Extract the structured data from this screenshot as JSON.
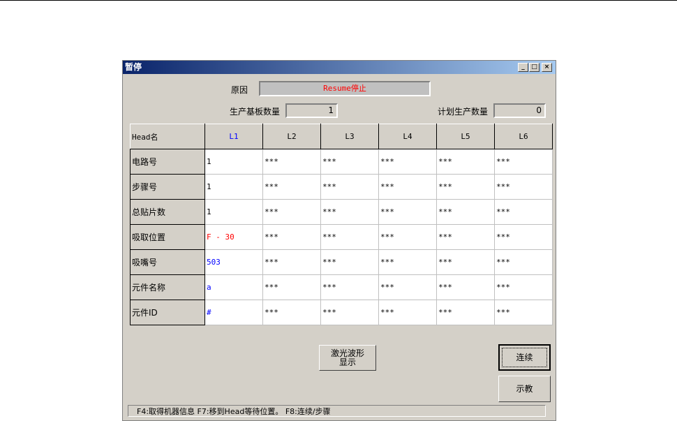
{
  "window": {
    "title": "暂停"
  },
  "reason": {
    "label": "原因",
    "value": "Resume停止"
  },
  "produced": {
    "label": "生产基板数量",
    "value": "1"
  },
  "planned": {
    "label": "计划生产数量",
    "value": "0"
  },
  "table": {
    "corner": "Head名",
    "columns": [
      "L1",
      "L2",
      "L3",
      "L4",
      "L5",
      "L6"
    ],
    "rows": [
      {
        "label": "电路号",
        "values": [
          "1",
          "***",
          "***",
          "***",
          "***",
          "***"
        ]
      },
      {
        "label": "步骤号",
        "values": [
          "1",
          "***",
          "***",
          "***",
          "***",
          "***"
        ]
      },
      {
        "label": "总贴片数",
        "values": [
          "1",
          "***",
          "***",
          "***",
          "***",
          "***"
        ]
      },
      {
        "label": "吸取位置",
        "values": [
          "F - 30",
          "***",
          "***",
          "***",
          "***",
          "***"
        ]
      },
      {
        "label": "吸嘴号",
        "values": [
          "503",
          "***",
          "***",
          "***",
          "***",
          "***"
        ]
      },
      {
        "label": "元件名称",
        "values": [
          "a",
          "***",
          "***",
          "***",
          "***",
          "***"
        ]
      },
      {
        "label": "元件ID",
        "values": [
          "#",
          "***",
          "***",
          "***",
          "***",
          "***"
        ]
      }
    ]
  },
  "buttons": {
    "laser": "激光波形\n显示",
    "laser1": "激光波形",
    "laser2": "显示",
    "continue": "连续",
    "teach": "示教"
  },
  "status": "F4:取得机器信息  F7:移到Head等待位置。  F8:连续/步骤",
  "colors": {
    "red": "#ff0000",
    "blue": "#0000ff"
  }
}
